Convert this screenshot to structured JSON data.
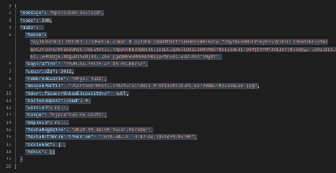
{
  "lines": [
    {
      "num": "1",
      "indent": 0,
      "tokens": [
        {
          "t": "p",
          "v": "{"
        }
      ]
    },
    {
      "num": "2",
      "indent": 2,
      "tokens": [
        {
          "t": "k",
          "v": "\"message\""
        },
        {
          "t": "p",
          "v": ": "
        },
        {
          "t": "s",
          "v": "\"Operación exitosa\""
        },
        {
          "t": "p",
          "v": ","
        }
      ]
    },
    {
      "num": "3",
      "indent": 2,
      "tokens": [
        {
          "t": "k",
          "v": "\"code\""
        },
        {
          "t": "p",
          "v": ": "
        },
        {
          "t": "n",
          "v": "200"
        },
        {
          "t": "p",
          "v": ","
        }
      ]
    },
    {
      "num": "4",
      "indent": 2,
      "tokens": [
        {
          "t": "k",
          "v": "\"data\""
        },
        {
          "t": "p",
          "v": ": {"
        }
      ]
    },
    {
      "num": "5",
      "indent": 4,
      "tokens": [
        {
          "t": "k",
          "v": "\"token\""
        },
        {
          "t": "p",
          "v": ":"
        }
      ]
    },
    {
      "num": "",
      "indent": 6,
      "tokens": [
        {
          "t": "s",
          "v": "\"eyJhbGciOiJIUzI1NiIsInR5cCI6IkpXVCJ9.eyJ1bmlxdWVfbmFtZSI6ImFydWl6IiwiY29ycmVvRWxlY3Ryb25pY28iOiJhbmdlbC5ydWl"
        }
      ]
    },
    {
      "num": "",
      "indent": 6,
      "tokens": [
        {
          "t": "s",
          "v": "6QGZvcnRlaW5ub3ZhdGlvbi5teCIsInRpcG9Db2dpbiI6IjIiLCJqdGkiOiI3ZmMzMzk4NS1jZWRiLTQ0MjQtYWY2Yi1iYjUxYWQyZTIwOGUiLCJlemIi"
        }
      ]
    },
    {
      "num": "",
      "indent": 6,
      "tokens": [
        {
          "t": "s",
          "v": "LCJleHAiOjE1ODgwOTYxMjN9.-Zhu-jg3qWPowMRkW8NBxjpPtnw0zl692-nhzfhWybY\""
        },
        {
          "t": "p",
          "v": ","
        }
      ]
    },
    {
      "num": "6",
      "indent": 4,
      "tokens": [
        {
          "t": "k",
          "v": "\"expiration\""
        },
        {
          "t": "p",
          "v": ": "
        },
        {
          "t": "s",
          "v": "\"2020-04-28T16:42:43.6820675Z\""
        },
        {
          "t": "p",
          "v": ","
        }
      ]
    },
    {
      "num": "7",
      "indent": 4,
      "tokens": [
        {
          "t": "k",
          "v": "\"usuarioId\""
        },
        {
          "t": "p",
          "v": ": "
        },
        {
          "t": "n",
          "v": "2011"
        },
        {
          "t": "p",
          "v": ","
        }
      ]
    },
    {
      "num": "8",
      "indent": 4,
      "tokens": [
        {
          "t": "k",
          "v": "\"nombreUsuario\""
        },
        {
          "t": "p",
          "v": ": "
        },
        {
          "t": "s",
          "v": "\"Angel Ruiz\""
        },
        {
          "t": "p",
          "v": ","
        }
      ]
    },
    {
      "num": "9",
      "indent": 4,
      "tokens": [
        {
          "t": "k",
          "v": "\"imagenPerfil\""
        },
        {
          "t": "p",
          "v": ": "
        },
        {
          "t": "s",
          "v": "\"/Content/ProfilePictures/2011_ProfilePicture_637200624935196236.jpg\""
        },
        {
          "t": "p",
          "v": ","
        }
      ]
    },
    {
      "num": "10",
      "indent": 4,
      "tokens": [
        {
          "t": "k",
          "v": "\"identificadorUnicoDispositivo\""
        },
        {
          "t": "p",
          "v": ": "
        },
        {
          "t": "n",
          "v": "null"
        },
        {
          "t": "p",
          "v": ","
        }
      ]
    },
    {
      "num": "11",
      "indent": 4,
      "tokens": [
        {
          "t": "k",
          "v": "\"sistemaOperativoId\""
        },
        {
          "t": "p",
          "v": ": "
        },
        {
          "t": "n",
          "v": "0"
        },
        {
          "t": "p",
          "v": ","
        }
      ]
    },
    {
      "num": "12",
      "indent": 4,
      "tokens": [
        {
          "t": "k",
          "v": "\"version\""
        },
        {
          "t": "p",
          "v": ": "
        },
        {
          "t": "n",
          "v": "null"
        },
        {
          "t": "p",
          "v": ","
        }
      ]
    },
    {
      "num": "13",
      "indent": 4,
      "tokens": [
        {
          "t": "k",
          "v": "\"cargo\""
        },
        {
          "t": "p",
          "v": ": "
        },
        {
          "t": "s",
          "v": "\"Ejecutivo de venta\""
        },
        {
          "t": "p",
          "v": ","
        }
      ]
    },
    {
      "num": "14",
      "indent": 4,
      "tokens": [
        {
          "t": "k",
          "v": "\"empresa\""
        },
        {
          "t": "p",
          "v": ": "
        },
        {
          "t": "n",
          "v": "null"
        },
        {
          "t": "p",
          "v": ","
        }
      ]
    },
    {
      "num": "15",
      "indent": 4,
      "tokens": [
        {
          "t": "k",
          "v": "\"fechaRegistro\""
        },
        {
          "t": "p",
          "v": ": "
        },
        {
          "t": "s",
          "v": "\"2020-04-15T09:46:24.0573154\""
        },
        {
          "t": "p",
          "v": ","
        }
      ]
    },
    {
      "num": "16",
      "indent": 4,
      "tokens": [
        {
          "t": "k",
          "v": "\"fechaUltimoInicioSesion\""
        },
        {
          "t": "p",
          "v": ": "
        },
        {
          "t": "s",
          "v": "\"2020-04-28T10:42:44.1461459-05:00\""
        },
        {
          "t": "p",
          "v": ","
        }
      ]
    },
    {
      "num": "17",
      "indent": 4,
      "tokens": [
        {
          "t": "k",
          "v": "\"acciones\""
        },
        {
          "t": "p",
          "v": ": [],"
        }
      ]
    },
    {
      "num": "18",
      "indent": 4,
      "tokens": [
        {
          "t": "k",
          "v": "\"menus\""
        },
        {
          "t": "p",
          "v": ": []"
        }
      ]
    },
    {
      "num": "19",
      "indent": 2,
      "tokens": [
        {
          "t": "p",
          "v": "}"
        }
      ]
    },
    {
      "num": "20",
      "indent": 0,
      "tokens": [
        {
          "t": "p",
          "v": "}"
        }
      ]
    }
  ]
}
